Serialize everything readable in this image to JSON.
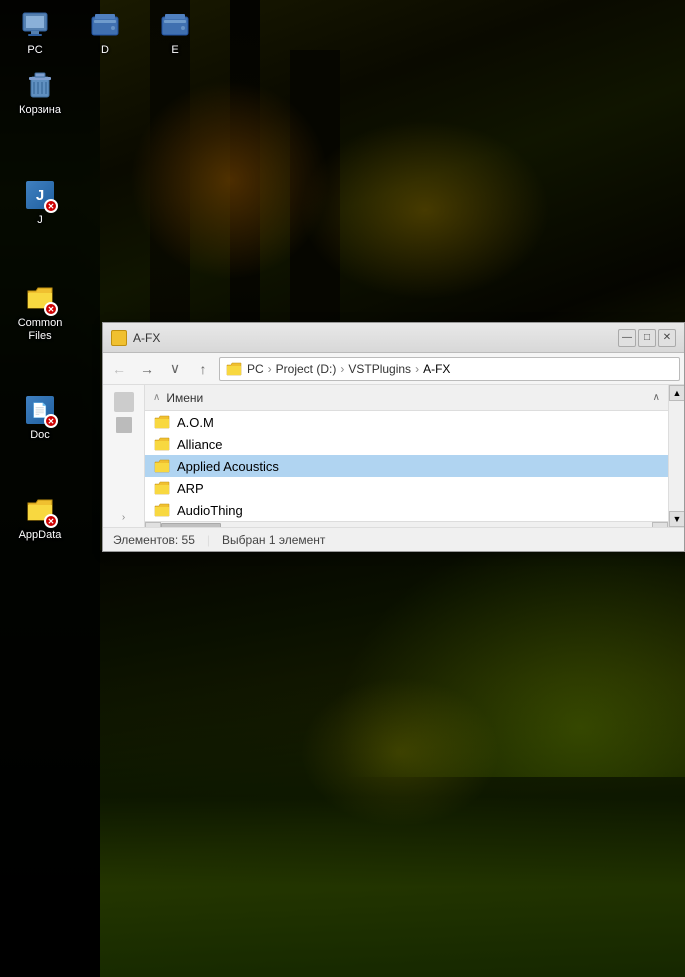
{
  "desktop": {
    "icons": [
      {
        "id": "pc",
        "label": "PC",
        "type": "pc",
        "col": 0,
        "row": 0
      },
      {
        "id": "d-drive",
        "label": "D",
        "type": "drive",
        "col": 1,
        "row": 0
      },
      {
        "id": "e-drive",
        "label": "E",
        "type": "drive",
        "col": 2,
        "row": 0
      },
      {
        "id": "recycle-bin",
        "label": "Корзина",
        "type": "bin",
        "col": 0,
        "row": 1
      },
      {
        "id": "j-app",
        "label": "J",
        "type": "app-error",
        "letter": "J",
        "col": 0,
        "row": 2
      },
      {
        "id": "common-files",
        "label": "Common\nFiles",
        "type": "folder-error",
        "col": 0,
        "row": 3
      },
      {
        "id": "doc",
        "label": "Doc",
        "type": "doc-error",
        "col": 0,
        "row": 4
      },
      {
        "id": "appdata",
        "label": "AppData",
        "type": "folder-error2",
        "col": 0,
        "row": 5
      }
    ]
  },
  "explorer": {
    "title": "A-FX",
    "breadcrumb": {
      "items": [
        "PC",
        "Project (D:)",
        "VSTPlugins",
        "A-FX"
      ]
    },
    "column_header": {
      "label": "Имени",
      "sort_arrow": "∧"
    },
    "files": [
      {
        "name": "A.O.M",
        "selected": false
      },
      {
        "name": "Alliance",
        "selected": false
      },
      {
        "name": "Applied Acoustics",
        "selected": true
      },
      {
        "name": "ARP",
        "selected": false
      },
      {
        "name": "AudioThing",
        "selected": false
      }
    ],
    "status": {
      "items_count": "Элементов: 55",
      "selected": "Выбран 1 элемент"
    },
    "nav_buttons": {
      "back": "←",
      "forward": "→",
      "dropdown": "∨",
      "up": "↑"
    }
  }
}
